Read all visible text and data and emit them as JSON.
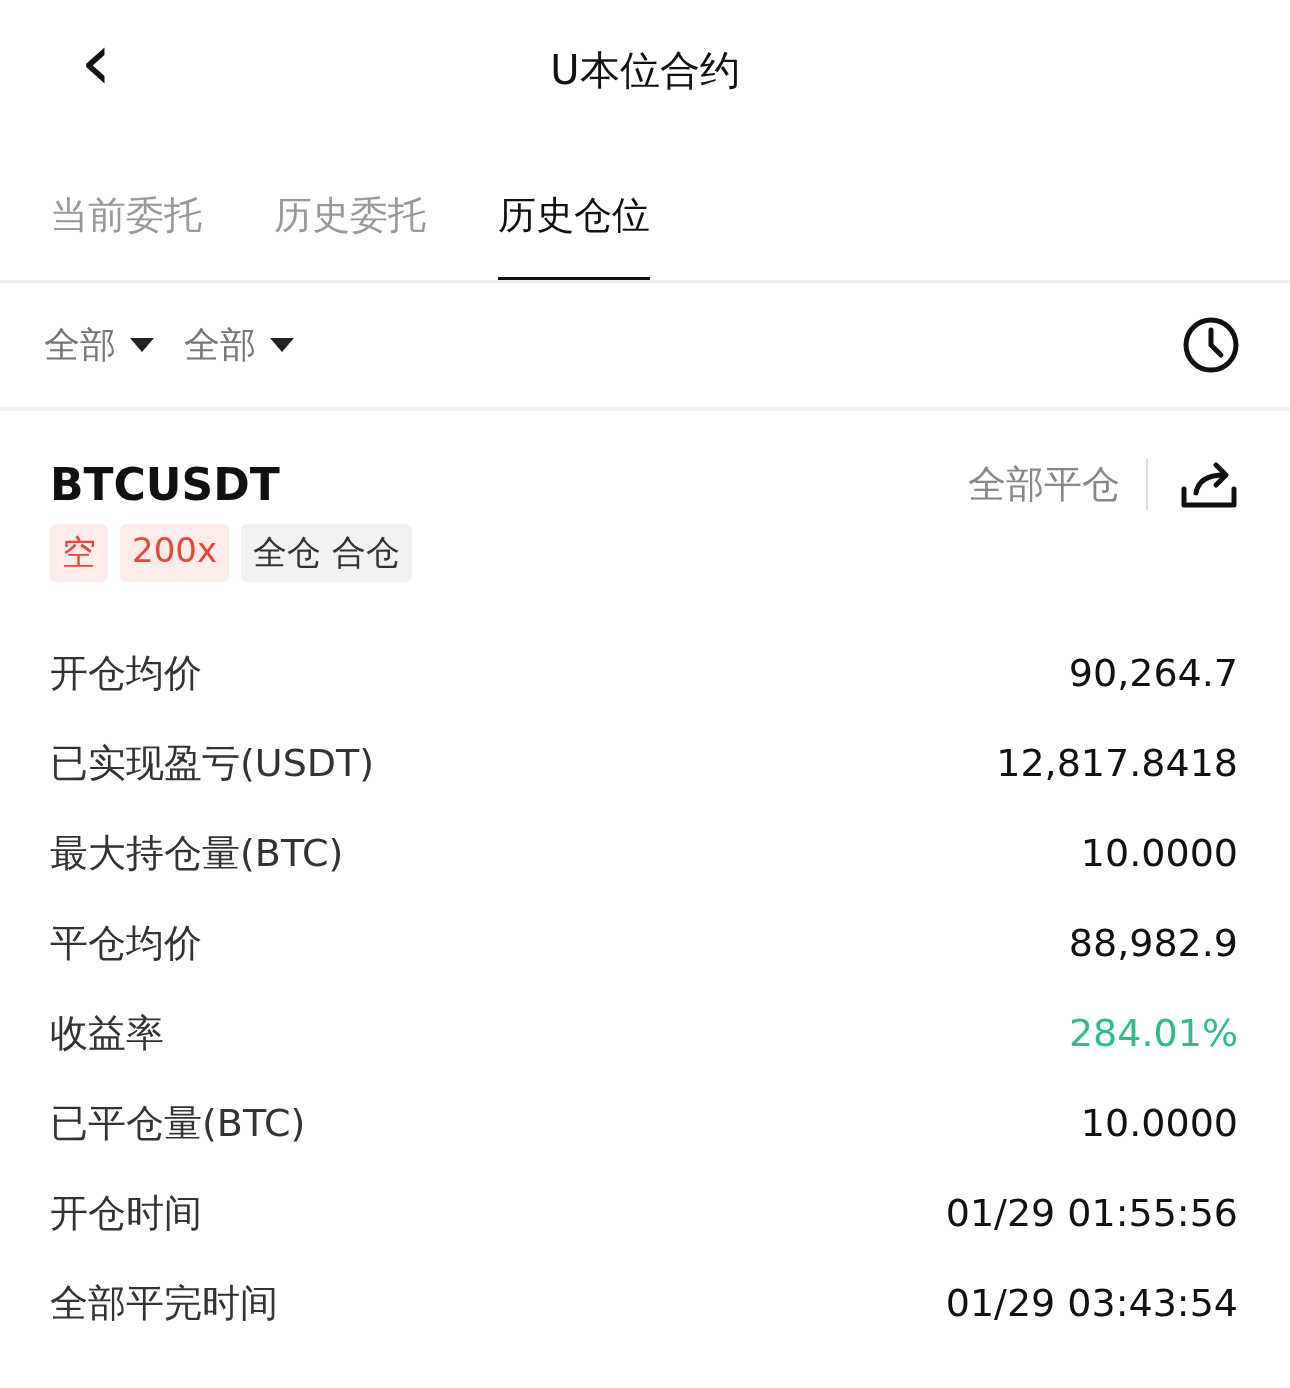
{
  "header": {
    "back": "‹",
    "title": "U本位合约"
  },
  "tabs": [
    {
      "label": "当前委托",
      "selected": false
    },
    {
      "label": "历史委托",
      "selected": false
    },
    {
      "label": "历史仓位",
      "selected": true
    }
  ],
  "filters": [
    {
      "label": "全部"
    },
    {
      "label": "全部"
    }
  ],
  "position": {
    "symbol": "BTCUSDT",
    "close_all": "全部平仓",
    "tags": [
      {
        "label": "空",
        "kind": "side"
      },
      {
        "label": "200x",
        "kind": "leverage"
      },
      {
        "label": "全仓 合仓",
        "kind": "mode"
      }
    ],
    "rows": [
      {
        "label": "开仓均价",
        "value": "90,264.7",
        "kind": "plain"
      },
      {
        "label": "已实现盈亏(USDT)",
        "value": "12,817.8418",
        "kind": "plain"
      },
      {
        "label": "最大持仓量(BTC)",
        "value": "10.0000",
        "kind": "plain"
      },
      {
        "label": "平仓均价",
        "value": "88,982.9",
        "kind": "plain"
      },
      {
        "label": "收益率",
        "value": "284.01%",
        "kind": "gain"
      },
      {
        "label": "已平仓量(BTC)",
        "value": "10.0000",
        "kind": "plain"
      },
      {
        "label": "开仓时间",
        "value": "01/29 01:55:56",
        "kind": "plain"
      },
      {
        "label": "全部平完时间",
        "value": "01/29 03:43:54",
        "kind": "plain"
      }
    ]
  }
}
